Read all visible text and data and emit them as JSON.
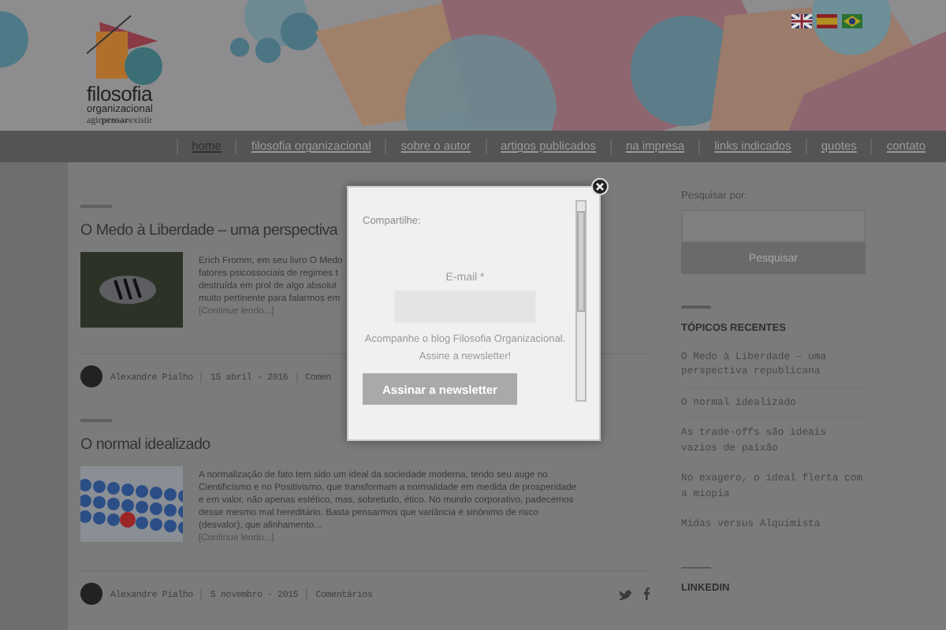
{
  "header": {
    "logo_title": "filosofia",
    "logo_subtitle": "organizacional",
    "logo_tagline": "agir**pensar**existir",
    "languages": [
      {
        "kind": "uk"
      },
      {
        "kind": "es"
      },
      {
        "kind": "br"
      }
    ]
  },
  "nav": [
    {
      "label": "home",
      "selected": true
    },
    {
      "label": "filosofia organizacional",
      "selected": false
    },
    {
      "label": "sobre o autor",
      "selected": false
    },
    {
      "label": "artigos publicados",
      "selected": false
    },
    {
      "label": "na impresa",
      "selected": false
    },
    {
      "label": "links indicados",
      "selected": false
    },
    {
      "label": "quotes",
      "selected": false
    },
    {
      "label": "contato",
      "selected": false
    }
  ],
  "posts": [
    {
      "title": "O Medo à Liberdade – uma perspectiva",
      "excerpt_lines": [
        "Erich Fromm, em seu livro O Medo",
        "fatores psicossociais de regimes t",
        "destruída em prol de algo absolut",
        "muito pertinente para falarmos em"
      ],
      "more": "[Continue lendo...]",
      "author": "Alexandre Pialho",
      "date": "15 abril - 2016",
      "comments": "Comen",
      "share": false
    },
    {
      "title": "O normal idealizado",
      "excerpt_lines": [
        "A normalização de fato tem sido um ideal da sociedade moderna, tendo seu auge no",
        "Cientificismo e no Positivismo, que transformam a normalidade em medida de prosperidade",
        "e em valor, não apenas estético, mas, sobretudo, ético. No mundo corporativo, padecemos",
        "desse mesmo mal hereditário. Basta pensarmos que variância é sinônimo de risco",
        "(desvalor), que alinhamento..."
      ],
      "more": "[Continue lendo...]",
      "author": "Alexandre Pialho",
      "date": "5 novembro - 2015",
      "comments": "Comentários",
      "share": true
    }
  ],
  "sidebar": {
    "search_label": "Pesquisar por:",
    "search_button": "Pesquisar",
    "recent_title": "TÓPICOS RECENTES",
    "recent": [
      "O Medo à Liberdade – uma perspectiva republicana",
      "O normal idealizado",
      "As trade-offs são ideais vazios de paixão",
      "No exagero, o ideal flerta com a miopia",
      "Midas versus Alquimista"
    ],
    "linkedin_title": "LINKEDIN"
  },
  "modal": {
    "share_label": "Compartilhe:",
    "email_label": "E-mail *",
    "note": "Acompanhe o blog Filosofia Organizacional. Assine a newsletter!",
    "button": "Assinar a newsletter"
  }
}
